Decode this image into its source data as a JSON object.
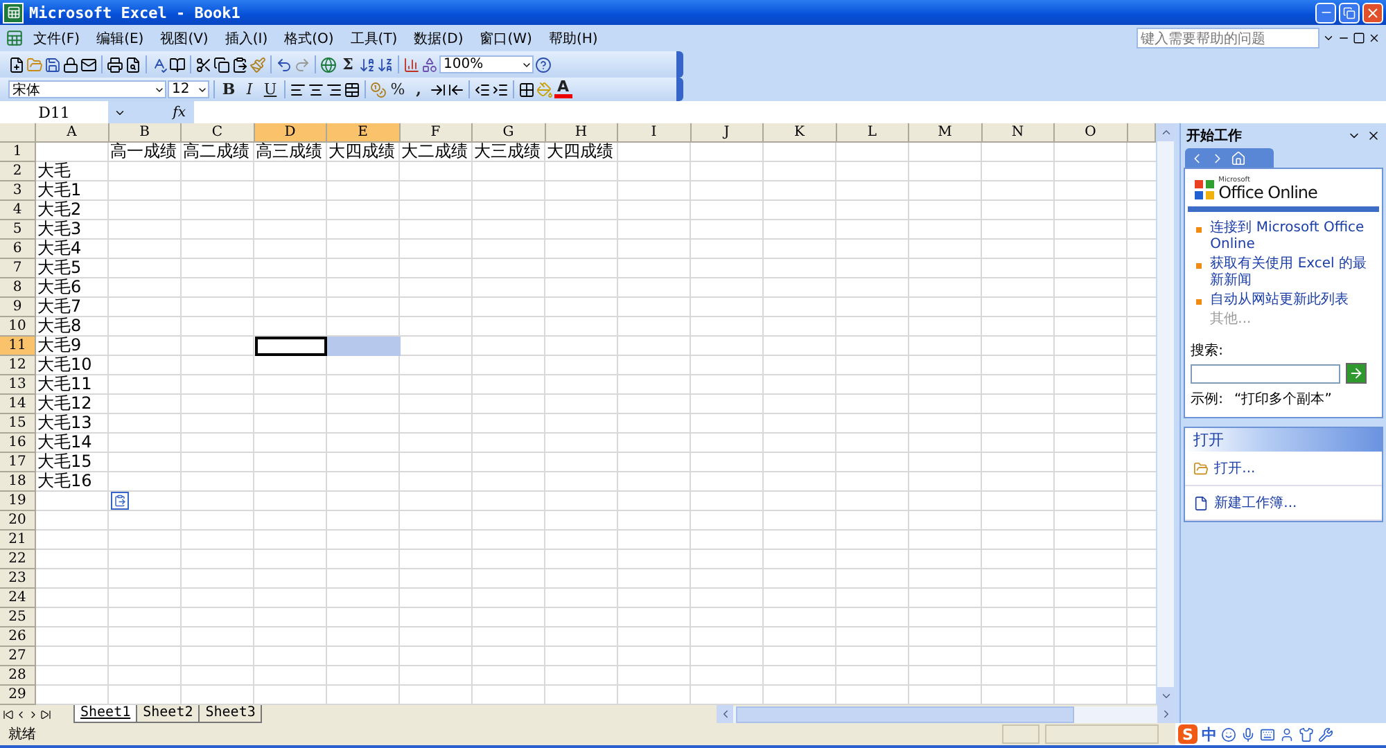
{
  "window": {
    "title": "Microsoft Excel - Book1"
  },
  "menu": {
    "items": [
      "文件(F)",
      "编辑(E)",
      "视图(V)",
      "插入(I)",
      "格式(O)",
      "工具(T)",
      "数据(D)",
      "窗口(W)",
      "帮助(H)"
    ],
    "help_placeholder": "键入需要帮助的问题"
  },
  "standard_toolbar": {
    "sum": "Σ",
    "zoom": "100%"
  },
  "formatting_toolbar": {
    "font": "宋体",
    "size": "12",
    "bold": "B",
    "italic": "I",
    "underline": "U",
    "percent": "%",
    "comma": ",",
    "font_color": "A"
  },
  "formula_bar": {
    "name_box": "D11",
    "fx": "fx"
  },
  "sheet": {
    "columns": [
      {
        "label": "A",
        "selected": false
      },
      {
        "label": "B",
        "selected": false
      },
      {
        "label": "C",
        "selected": false
      },
      {
        "label": "D",
        "selected": true
      },
      {
        "label": "E",
        "selected": true
      },
      {
        "label": "F",
        "selected": false
      },
      {
        "label": "G",
        "selected": false
      },
      {
        "label": "H",
        "selected": false
      },
      {
        "label": "I",
        "selected": false
      },
      {
        "label": "J",
        "selected": false
      },
      {
        "label": "K",
        "selected": false
      },
      {
        "label": "L",
        "selected": false
      },
      {
        "label": "M",
        "selected": false
      },
      {
        "label": "N",
        "selected": false
      },
      {
        "label": "O",
        "selected": false
      }
    ],
    "rows": [
      {
        "label": "1",
        "selected": false,
        "cells": {
          "B": "高一成绩",
          "C": "高二成绩",
          "D": "高三成绩",
          "E": "大四成绩",
          "F": "大二成绩",
          "G": "大三成绩",
          "H": "大四成绩"
        }
      },
      {
        "label": "2",
        "selected": false,
        "cells": {
          "A": "大毛"
        }
      },
      {
        "label": "3",
        "selected": false,
        "cells": {
          "A": "大毛1"
        }
      },
      {
        "label": "4",
        "selected": false,
        "cells": {
          "A": "大毛2"
        }
      },
      {
        "label": "5",
        "selected": false,
        "cells": {
          "A": "大毛3"
        }
      },
      {
        "label": "6",
        "selected": false,
        "cells": {
          "A": "大毛4"
        }
      },
      {
        "label": "7",
        "selected": false,
        "cells": {
          "A": "大毛5"
        }
      },
      {
        "label": "8",
        "selected": false,
        "cells": {
          "A": "大毛6"
        }
      },
      {
        "label": "9",
        "selected": false,
        "cells": {
          "A": "大毛7"
        }
      },
      {
        "label": "10",
        "selected": false,
        "cells": {
          "A": "大毛8"
        }
      },
      {
        "label": "11",
        "selected": true,
        "cells": {
          "A": "大毛9"
        }
      },
      {
        "label": "12",
        "selected": false,
        "cells": {
          "A": "大毛10"
        }
      },
      {
        "label": "13",
        "selected": false,
        "cells": {
          "A": "大毛11"
        }
      },
      {
        "label": "14",
        "selected": false,
        "cells": {
          "A": "大毛12"
        }
      },
      {
        "label": "15",
        "selected": false,
        "cells": {
          "A": "大毛13"
        }
      },
      {
        "label": "16",
        "selected": false,
        "cells": {
          "A": "大毛14"
        }
      },
      {
        "label": "17",
        "selected": false,
        "cells": {
          "A": "大毛15"
        }
      },
      {
        "label": "18",
        "selected": false,
        "cells": {
          "A": "大毛16"
        }
      },
      {
        "label": "19",
        "selected": false,
        "paste_options": true
      },
      {
        "label": "20",
        "selected": false
      },
      {
        "label": "21",
        "selected": false
      },
      {
        "label": "22",
        "selected": false
      },
      {
        "label": "23",
        "selected": false
      },
      {
        "label": "24",
        "selected": false
      },
      {
        "label": "25",
        "selected": false
      },
      {
        "label": "26",
        "selected": false
      },
      {
        "label": "27",
        "selected": false
      },
      {
        "label": "28",
        "selected": false
      },
      {
        "label": "29",
        "selected": false
      }
    ]
  },
  "sheet_tabs": [
    {
      "label": "Sheet1",
      "selected": true
    },
    {
      "label": "Sheet2",
      "selected": false
    },
    {
      "label": "Sheet3",
      "selected": false
    }
  ],
  "status_bar": {
    "text": "就绪"
  },
  "task_pane": {
    "title": "开始工作",
    "logo_small": "Microsoft",
    "logo": "Office Online",
    "links": [
      {
        "label": "连接到 Microsoft Office Online",
        "disabled": false
      },
      {
        "label": "获取有关使用 Excel 的最新新闻",
        "disabled": false
      },
      {
        "label": "自动从网站更新此列表",
        "disabled": false
      },
      {
        "label": "其他...",
        "disabled": true
      }
    ],
    "search_label": "搜索:",
    "example_label": "示例:",
    "example": "“打印多个副本”",
    "section": "打开",
    "items": [
      {
        "kind": "open",
        "label": "打开..."
      },
      {
        "kind": "new",
        "label": "新建工作簿..."
      }
    ]
  },
  "ime_bar": {
    "logo": "S",
    "mode": "中"
  }
}
